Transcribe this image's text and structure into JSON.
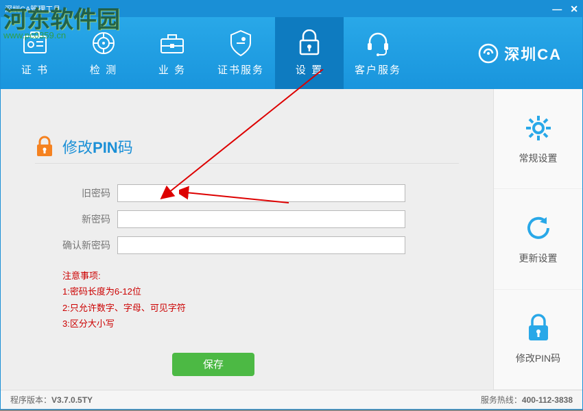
{
  "titlebar": {
    "title": "深圳CA管理工具"
  },
  "watermark": {
    "text": "河东软件园",
    "url": "www.pc0359.cn"
  },
  "nav": {
    "items": [
      {
        "label": "证 书",
        "icon": "certificate-icon"
      },
      {
        "label": "检 测",
        "icon": "detect-icon"
      },
      {
        "label": "业 务",
        "icon": "business-icon"
      },
      {
        "label": "证书服务",
        "icon": "cert-service-icon"
      },
      {
        "label": "设 置",
        "icon": "settings-lock-icon"
      },
      {
        "label": "客户服务",
        "icon": "headset-icon"
      }
    ]
  },
  "brand": {
    "text": "深圳CA"
  },
  "panel": {
    "title_prefix": "修改",
    "title_strong": "PIN",
    "title_suffix": "码",
    "fields": {
      "old_label": "旧密码",
      "new_label": "新密码",
      "confirm_label": "确认新密码",
      "old_value": "",
      "new_value": "",
      "confirm_value": ""
    },
    "notice_heading": "注意事项:",
    "notice_lines": [
      "1:密码长度为6-12位",
      "2:只允许数字、字母、可见字符",
      "3:区分大小写"
    ],
    "save_label": "保存"
  },
  "sidebar": {
    "items": [
      {
        "label": "常规设置",
        "name": "general-settings"
      },
      {
        "label": "更新设置",
        "name": "update-settings"
      },
      {
        "label": "修改PIN码",
        "name": "change-pin"
      }
    ]
  },
  "statusbar": {
    "version_label": "程序版本：",
    "version_value": "V3.7.0.5TY",
    "hotline_label": "服务热线：",
    "hotline_value": "400-112-3838"
  }
}
